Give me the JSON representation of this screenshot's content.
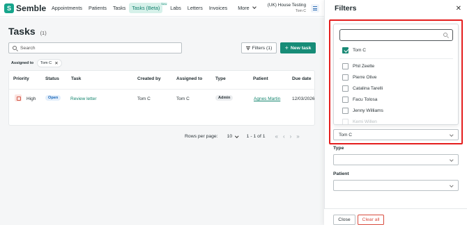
{
  "app": {
    "name": "Semble",
    "logo_letter": "S"
  },
  "nav": {
    "items": [
      "Appointments",
      "Patients",
      "Tasks",
      "Tasks (Beta)",
      "Labs",
      "Letters",
      "Invoices",
      "More"
    ],
    "active": "Tasks (Beta)",
    "new_tag": "New"
  },
  "org": {
    "name": "(UK) House Testing",
    "user": "Tom C"
  },
  "page": {
    "title": "Tasks",
    "count": "(1)"
  },
  "search": {
    "placeholder": "Search"
  },
  "toolbar": {
    "filters_label": "Filters (1)",
    "new_task_label": "New task"
  },
  "active_filter": {
    "label": "Assigned to",
    "chip": "Tom C"
  },
  "table": {
    "headers": [
      "Priority",
      "Status",
      "Task",
      "Created by",
      "Assigned to",
      "Type",
      "Patient",
      "Due date"
    ],
    "rows": [
      {
        "priority": "High",
        "status": "Open",
        "task": "Review letter",
        "created_by": "Tom C",
        "assigned_to": "Tom C",
        "type": "Admin",
        "patient": "Agnes Martin",
        "due_date": "12/03/2026"
      }
    ]
  },
  "pagination": {
    "rows_per_page_label": "Rows per page:",
    "rows_per_page": "10",
    "range": "1 - 1 of 1"
  },
  "filters_panel": {
    "title": "Filters",
    "assignee_search": {
      "value": "",
      "placeholder": ""
    },
    "options": [
      {
        "name": "Tom C",
        "checked": true
      },
      {
        "name": "Phil Zeelte",
        "checked": false
      },
      {
        "name": "Pierre Olive",
        "checked": false
      },
      {
        "name": "Catalina Tarelli",
        "checked": false
      },
      {
        "name": "Facu Tolosa",
        "checked": false
      },
      {
        "name": "Jenny Williams",
        "checked": false
      },
      {
        "name": "Kemi Willen",
        "checked": false
      }
    ],
    "assigned_to_value": "Tom C",
    "type_label": "Type",
    "type_value": "",
    "patient_label": "Patient",
    "patient_value": "",
    "close_label": "Close",
    "clear_label": "Clear all"
  },
  "colors": {
    "brand": "#17a58c",
    "primary_button": "#178c77",
    "highlight_box": "#e41e1e",
    "danger": "#d84a3d"
  }
}
